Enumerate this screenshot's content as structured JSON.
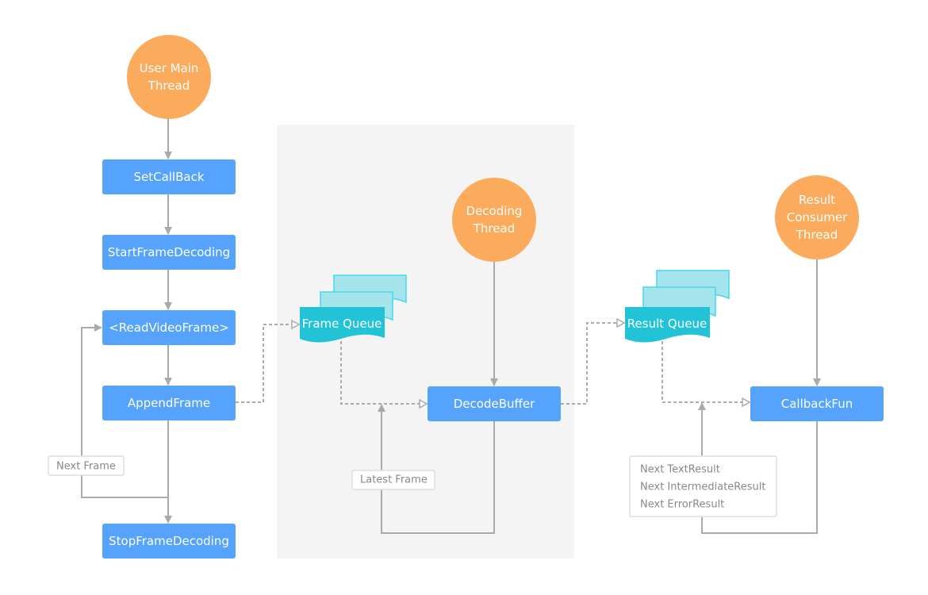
{
  "threads": {
    "user_main": "User Main Thread",
    "decoding": "Decoding Thread",
    "result_consumer": "Result Consumer Thread"
  },
  "thread_lines": {
    "user_main": [
      "User Main",
      "Thread"
    ],
    "decoding": [
      "Decoding",
      "Thread"
    ],
    "result_consumer": [
      "Result",
      "Consumer",
      "Thread"
    ]
  },
  "steps": {
    "set_callback": "SetCallBack",
    "start_frame_decoding": "StartFrameDecoding",
    "read_video_frame": "<ReadVideoFrame>",
    "append_frame": "AppendFrame",
    "stop_frame_decoding": "StopFrameDecoding",
    "decode_buffer": "DecodeBuffer",
    "callback_fun": "CallbackFun"
  },
  "queues": {
    "frame_queue": "Frame Queue",
    "result_queue": "Result Queue"
  },
  "labels": {
    "next_frame": "Next Frame",
    "latest_frame": "Latest Frame",
    "next_results": [
      "Next TextResult",
      "Next IntermediateResult",
      "Next ErrorResult"
    ]
  },
  "colors": {
    "thread": "#fbab5b",
    "step": "#55a3fc",
    "queue": "#22c3d7",
    "queue_back": "#a5e4ec",
    "connector": "#aaaaaa",
    "panel": "#f4f4f4"
  }
}
